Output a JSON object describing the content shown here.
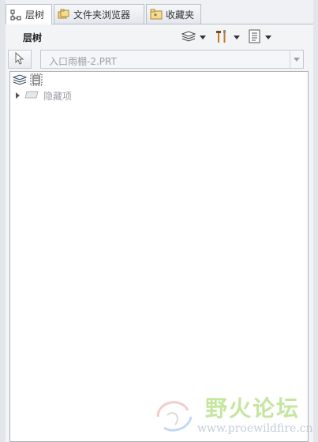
{
  "tabs": [
    {
      "label": "层树",
      "icon": "layer-tree-icon",
      "active": true
    },
    {
      "label": "文件夹浏览器",
      "icon": "folder-browser-icon",
      "active": false
    },
    {
      "label": "收藏夹",
      "icon": "favorites-icon",
      "active": false
    }
  ],
  "toolbar": {
    "title": "层树",
    "buttons": [
      {
        "icon": "layers-icon"
      },
      {
        "icon": "tools-icon"
      },
      {
        "icon": "settings-list-icon"
      }
    ]
  },
  "selector": {
    "pick_icon": "cursor-arrow-icon",
    "value": "入口雨棚-2.PRT"
  },
  "tree": {
    "root_icons": [
      "layers-icon",
      "layer-node-icon"
    ],
    "items": [
      {
        "label": "隐藏项",
        "icon": "hidden-layer-icon",
        "expandable": true
      }
    ]
  },
  "watermark": {
    "text": "野火论坛",
    "url": "www.proewildfire.cn"
  },
  "colors": {
    "panel_bg": "#f3f4f6",
    "tree_bg": "#ffffff",
    "disabled_text": "#9a9ea6",
    "watermark_green": "#96d250"
  }
}
